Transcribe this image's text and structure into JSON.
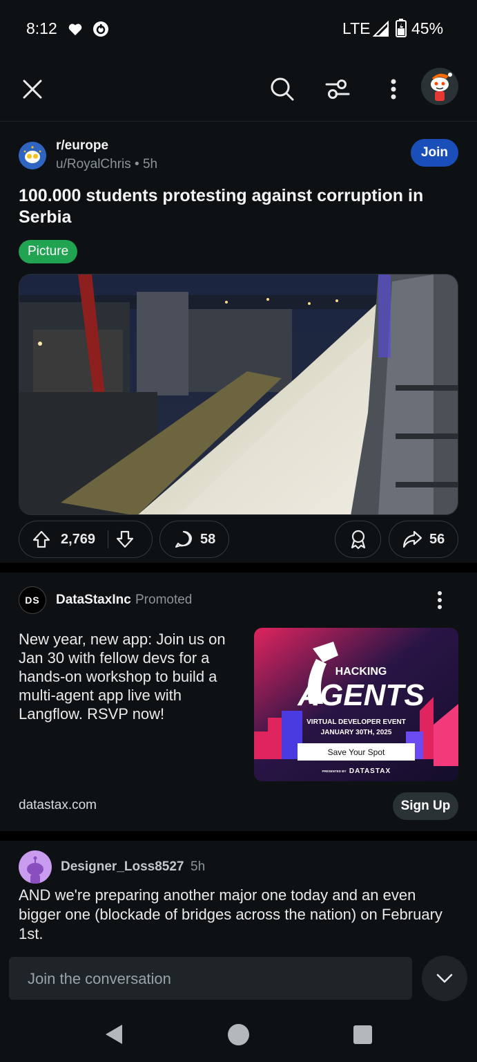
{
  "status_bar": {
    "time": "8:12",
    "network": "LTE",
    "battery": "45%"
  },
  "post": {
    "subreddit": "r/europe",
    "author": "u/RoyalChris",
    "age": "5h",
    "join_label": "Join",
    "title": "100.000 students protesting against corruption in Serbia",
    "flair": "Picture",
    "upvotes": "2,769",
    "comments": "58",
    "shares": "56"
  },
  "promo": {
    "logo_text": "DS",
    "advertiser": "DataStaxInc",
    "tag": "Promoted",
    "text": "New year, new app: Join us on Jan 30 with fellow devs for a hands-on workshop to build a multi-agent app live with Langflow. RSVP now!",
    "banner": {
      "line1": "HACKING",
      "line2": "AGENTS",
      "line3": "VIRTUAL DEVELOPER EVENT",
      "line4": "JANUARY 30TH, 2025",
      "cta": "Save Your Spot",
      "presented": "PRESENTED BY",
      "brand": "DATASTAX"
    },
    "domain": "datastax.com",
    "signup_label": "Sign Up"
  },
  "comment": {
    "user": "Designer_Loss8527",
    "age": "5h",
    "body": "AND we're preparing another major one today and an even bigger one (blockade of bridges across the nation) on February 1st."
  },
  "reply": {
    "placeholder": "Join the conversation"
  },
  "colors": {
    "background": "#0e1113",
    "join_button": "#1a4eb8",
    "flair_green": "#20a451"
  }
}
